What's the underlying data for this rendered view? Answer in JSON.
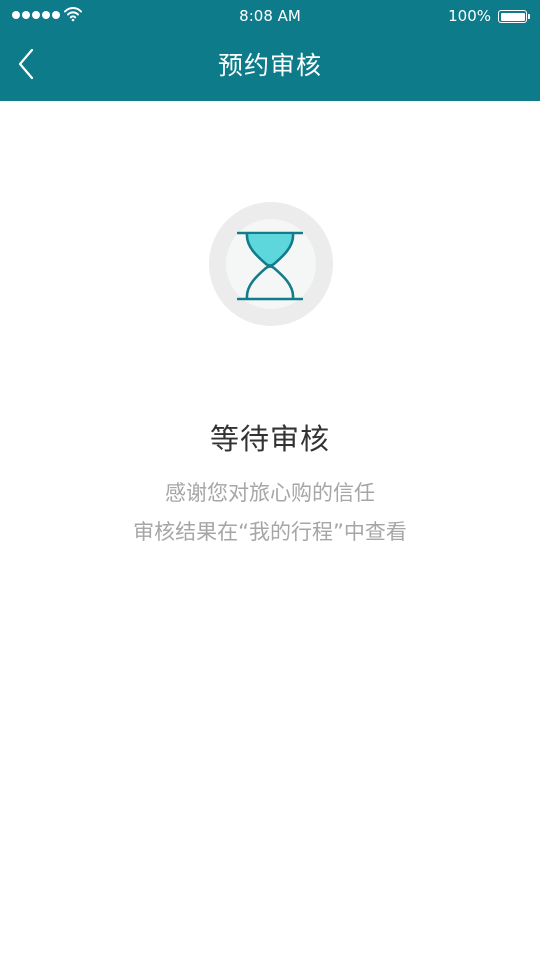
{
  "status_bar": {
    "time": "8:08 AM",
    "battery": "100%",
    "signal_icon": "signal-dots-icon",
    "wifi_icon": "wifi-icon",
    "battery_icon": "battery-icon"
  },
  "nav": {
    "title": "预约审核",
    "back_icon": "chevron-left-icon"
  },
  "status": {
    "icon": "hourglass-icon",
    "title": "等待审核",
    "line1": "感谢您对旅心购的信任",
    "line2": "审核结果在“我的行程”中查看"
  },
  "colors": {
    "header_bg": "#0e7b8a",
    "hourglass_fill": "#5dd7dc",
    "hourglass_stroke": "#137c8a",
    "title_text": "#333333",
    "subtitle_text": "#a6a6a6"
  }
}
